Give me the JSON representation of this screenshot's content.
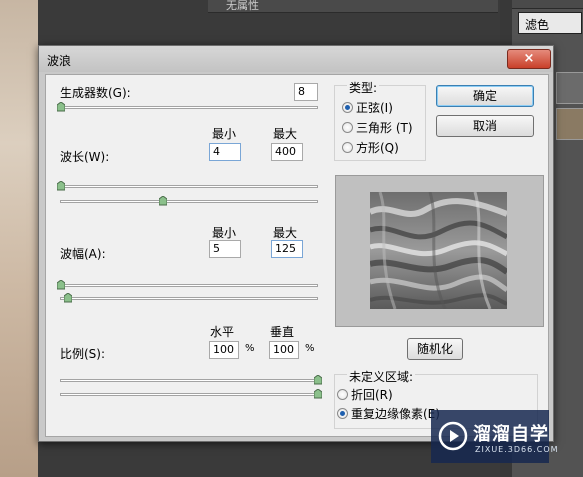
{
  "background": {
    "top_panel_label": "无属性",
    "right_panel_dropdown": "滤色"
  },
  "dialog": {
    "title": "波浪",
    "close_symbol": "×",
    "generators": {
      "label": "生成器数(G):",
      "value": "8",
      "slider_fraction": 0.0
    },
    "wavelength": {
      "label": "波长(W):",
      "min_header": "最小",
      "max_header": "最大",
      "min": "4",
      "max": "400",
      "min_slider_fraction": 0.0,
      "max_slider_fraction": 0.4
    },
    "amplitude": {
      "label": "波幅(A):",
      "min_header": "最小",
      "max_header": "最大",
      "min": "5",
      "max": "125",
      "min_slider_fraction": 0.0,
      "max_slider_fraction": 0.03
    },
    "scale": {
      "label": "比例(S):",
      "h_header": "水平",
      "v_header": "垂直",
      "h": "100",
      "v": "100",
      "unit": "%",
      "h_slider_fraction": 1.0,
      "v_slider_fraction": 1.0
    },
    "type_group": {
      "title": "类型:",
      "options": [
        {
          "label": "正弦(I)",
          "selected": true
        },
        {
          "label": "三角形 (T)",
          "selected": false
        },
        {
          "label": "方形(Q)",
          "selected": false
        }
      ]
    },
    "buttons": {
      "ok": "确定",
      "cancel": "取消",
      "randomize": "随机化"
    },
    "undefined_area": {
      "title": "未定义区域:",
      "options": [
        {
          "label": "折回(R)",
          "selected": false
        },
        {
          "label": "重复边缘像素(E)",
          "selected": true
        }
      ]
    }
  },
  "watermark": {
    "name": "溜溜自学",
    "url": "ZIXUE.3D66.COM"
  },
  "colors": {
    "accent": "#1e5fae",
    "close": "#c9402a"
  }
}
